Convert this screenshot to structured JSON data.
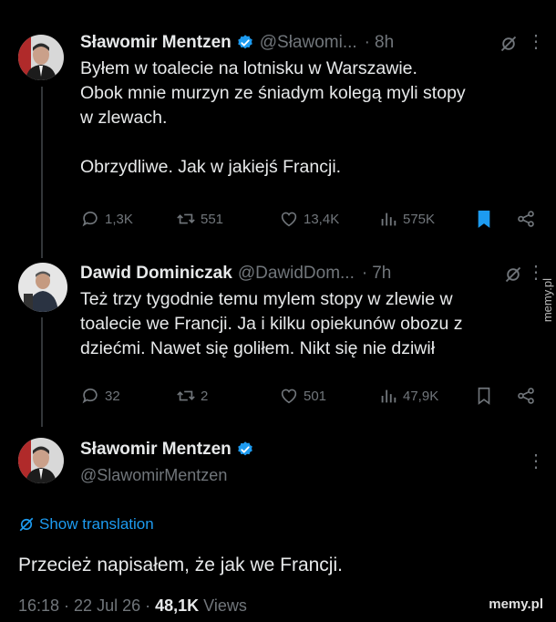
{
  "tweet1": {
    "name": "Sławomir Mentzen",
    "handle": "@Sławomi...",
    "time": "8h",
    "text": "Byłem w toalecie na lotnisku w Warszawie.\nObok mnie murzyn ze śniadym kolegą myli stopy\nw zlewach.\n\nObrzydliwe. Jak w jakiejś Francji.",
    "replies": "1,3K",
    "reposts": "551",
    "likes": "13,4K",
    "views": "575K"
  },
  "tweet2": {
    "name": "Dawid Dominiczak",
    "handle": "@DawidDom...",
    "time": "7h",
    "text": "Też trzy tygodnie temu mylem stopy w zlewie w\ntoalecie we Francji. Ja i kilku opiekunów obozu z\ndziećmi. Nawet się goliłem. Nikt się nie dziwił",
    "replies": "32",
    "reposts": "2",
    "likes": "501",
    "views": "47,9K"
  },
  "tweet3": {
    "name": "Sławomir Mentzen",
    "handle": "@SlawomirMentzen",
    "translate_label": "Show translation",
    "text": "Przecież napisałem, że jak we Francji.",
    "timestamp": "16:18 · 22 Jul 26 · ",
    "view_count": "48,1K",
    "views_label": " Views"
  },
  "watermark": "memy.pl",
  "colors": {
    "background": "#000000",
    "text": "#e7e9ea",
    "muted": "#71767b",
    "accent": "#1d9bf0",
    "thread_line": "#333639"
  },
  "icons": [
    "verified-badge-icon",
    "grok-icon",
    "more-icon",
    "reply-icon",
    "repost-icon",
    "like-icon",
    "views-icon",
    "bookmark-icon",
    "share-icon",
    "translate-icon"
  ]
}
